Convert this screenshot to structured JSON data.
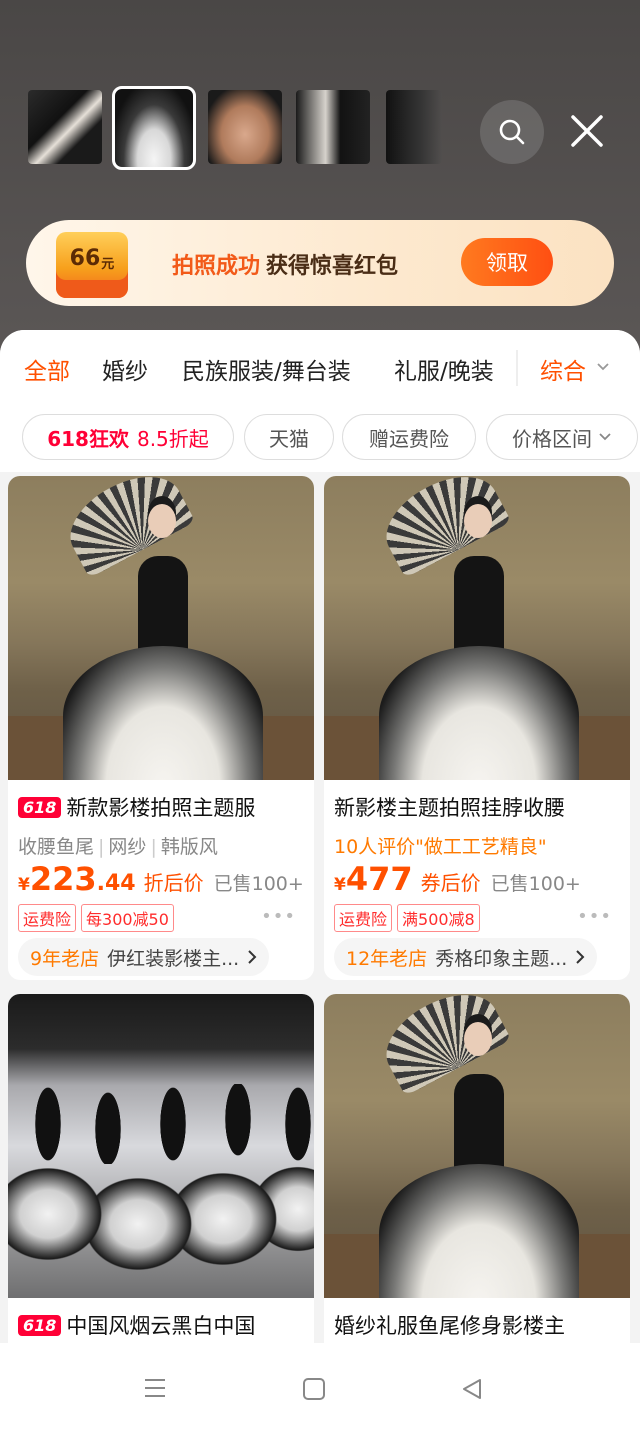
{
  "banner": {
    "coupon_amount": "66",
    "coupon_unit": "元",
    "highlight": "拍照成功",
    "text": "获得惊喜红包",
    "claim_label": "领取"
  },
  "tabs": [
    "全部",
    "婚纱",
    "民族服装/舞台装",
    "礼服/晚装"
  ],
  "sort_label": "综合",
  "chips": {
    "promo_a": "618狂欢",
    "promo_b": "8.5折起",
    "tmall": "天猫",
    "insurance": "赠运费险",
    "price_range": "价格区间"
  },
  "products": [
    {
      "badge": "618",
      "title": "新款影楼拍照主题服",
      "features": [
        "收腰鱼尾",
        "网纱",
        "韩版风"
      ],
      "currency": "¥",
      "price_int": "223",
      "price_dec": ".44",
      "price_label": "折后价",
      "sold": "已售100+",
      "tags": [
        "运费险",
        "每300减50"
      ],
      "shop_age": "9年老店",
      "shop_name": "伊红装影楼主..."
    },
    {
      "badge": "",
      "title": "新影楼主题拍照挂脖收腰",
      "review": "10人评价\"做工工艺精良\"",
      "currency": "¥",
      "price_int": "477",
      "price_dec": "",
      "price_label": "券后价",
      "sold": "已售100+",
      "tags": [
        "运费险",
        "满500减8"
      ],
      "shop_age": "12年老店",
      "shop_name": "秀格印象主题..."
    },
    {
      "badge": "618",
      "title": "中国风烟云黑白中国"
    },
    {
      "badge": "",
      "title": "婚纱礼服鱼尾修身影楼主"
    }
  ]
}
